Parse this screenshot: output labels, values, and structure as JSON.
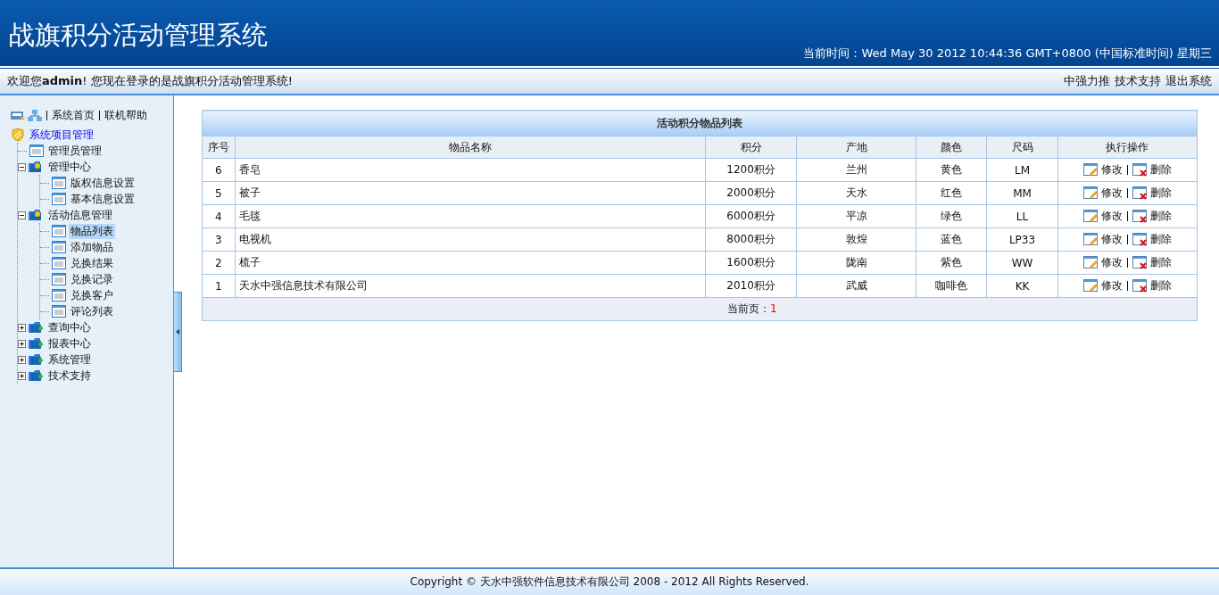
{
  "header": {
    "title": "战旗积分活动管理系统",
    "clock": "当前时间：Wed May 30 2012 10:44:36 GMT+0800 (中国标准时间) 星期三"
  },
  "welcome_bar": {
    "message": "欢迎您**admin**! 您现在登录的是战旗积分活动管理系统!",
    "links": [
      "中强力推",
      "技术支持",
      "退出系统"
    ]
  },
  "sidebar": {
    "links": [
      "系统首页",
      "联机帮助"
    ],
    "tree": {
      "label": "系统项目管理",
      "children": [
        {
          "label": "管理员管理",
          "kind": "page",
          "selected": false
        },
        {
          "label": "管理中心",
          "kind": "folder",
          "expanded": true,
          "children": [
            {
              "label": "版权信息设置",
              "kind": "page",
              "selected": false
            },
            {
              "label": "基本信息设置",
              "kind": "page",
              "selected": false
            }
          ]
        },
        {
          "label": "活动信息管理",
          "kind": "folder",
          "expanded": true,
          "children": [
            {
              "label": "物品列表",
              "kind": "page",
              "selected": true
            },
            {
              "label": "添加物品",
              "kind": "page",
              "selected": false
            },
            {
              "label": "兑换结果",
              "kind": "page",
              "selected": false
            },
            {
              "label": "兑换记录",
              "kind": "page",
              "selected": false
            },
            {
              "label": "兑换客户",
              "kind": "page",
              "selected": false
            },
            {
              "label": "评论列表",
              "kind": "page",
              "selected": false
            }
          ]
        },
        {
          "label": "查询中心",
          "kind": "folder",
          "expanded": false
        },
        {
          "label": "报表中心",
          "kind": "folder",
          "expanded": false
        },
        {
          "label": "系统管理",
          "kind": "folder",
          "expanded": false
        },
        {
          "label": "技术支持",
          "kind": "folder",
          "expanded": false
        }
      ]
    }
  },
  "table": {
    "title": "活动积分物品列表",
    "columns": [
      "序号",
      "物品名称",
      "积分",
      "产地",
      "颜色",
      "尺码",
      "执行操作"
    ],
    "rows": [
      {
        "cells": [
          "6",
          "香皂",
          "1200积分",
          "兰州",
          "黄色",
          "LM"
        ],
        "actions": [
          {
            "kind": "edit",
            "label": "修改"
          },
          {
            "kind": "delete",
            "label": "删除"
          }
        ]
      },
      {
        "cells": [
          "5",
          "被子",
          "2000积分",
          "天水",
          "红色",
          "MM"
        ],
        "actions": [
          {
            "kind": "edit",
            "label": "修改"
          },
          {
            "kind": "delete",
            "label": "删除"
          }
        ]
      },
      {
        "cells": [
          "4",
          "毛毯",
          "6000积分",
          "平凉",
          "绿色",
          "LL"
        ],
        "actions": [
          {
            "kind": "edit",
            "label": "修改"
          },
          {
            "kind": "delete",
            "label": "删除"
          }
        ]
      },
      {
        "cells": [
          "3",
          "电视机",
          "8000积分",
          "敦煌",
          "蓝色",
          "LP33"
        ],
        "actions": [
          {
            "kind": "edit",
            "label": "修改"
          },
          {
            "kind": "delete",
            "label": "删除"
          }
        ]
      },
      {
        "cells": [
          "2",
          "梳子",
          "1600积分",
          "陇南",
          "紫色",
          "WW"
        ],
        "actions": [
          {
            "kind": "edit",
            "label": "修改"
          },
          {
            "kind": "delete",
            "label": "删除"
          }
        ]
      },
      {
        "cells": [
          "1",
          "天水中强信息技术有限公司",
          "2010积分",
          "武威",
          "咖啡色",
          "KK"
        ],
        "actions": [
          {
            "kind": "edit",
            "label": "修改"
          },
          {
            "kind": "delete",
            "label": "删除"
          }
        ]
      }
    ],
    "pager": {
      "label": "当前页：",
      "page": "1"
    }
  },
  "footer": "Copyright © 天水中强软件信息技术有限公司 2008 - 2012 All Rights Reserved."
}
